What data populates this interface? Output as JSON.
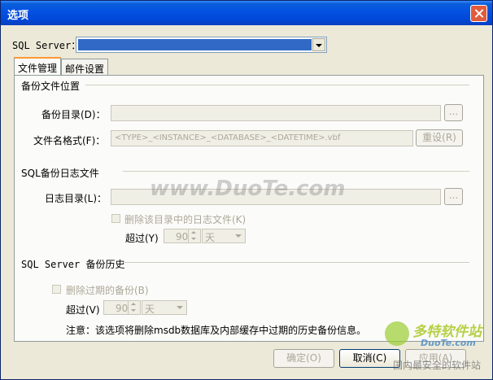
{
  "window": {
    "title": "选项"
  },
  "server": {
    "label": "SQL Server：",
    "value": ""
  },
  "tabs": [
    {
      "label": "文件管理",
      "active": true
    },
    {
      "label": "邮件设置",
      "active": false
    }
  ],
  "backup_file_location": {
    "heading": "备份文件位置",
    "dir_label": "备份目录(D)：",
    "dir_value": "",
    "browse_label": "...",
    "filename_label": "文件名格式(F)：",
    "filename_value": "<TYPE>_<INSTANCE>_<DATABASE>_<DATETIME>.vbf",
    "reset_label": "重设(R)"
  },
  "sql_log": {
    "heading": "SQL备份日志文件",
    "dir_label": "日志目录(L)：",
    "dir_value": "",
    "browse_label": "...",
    "delete_label": "删除该目录中的日志文件(K)",
    "over_label": "超过(Y)",
    "over_value": "90",
    "unit": "天"
  },
  "history": {
    "heading": "SQL Server 备份历史",
    "delete_label": "删除过期的备份(B)",
    "over_label": "超过(V)",
    "over_value": "90",
    "unit": "天",
    "note": "注意：该选项将删除msdb数据库及内部缓存中过期的历史备份信息。"
  },
  "footer": {
    "ok": "确定(O)",
    "cancel": "取消(C)",
    "apply": "应用(A)"
  },
  "watermarks": {
    "center": "www.DuoTe.com",
    "logo_title": "多特软件站",
    "logo_url": "DuoTe.com",
    "logo_sub": "国内最安全的软件站"
  },
  "colors": {
    "title_bar": "#0553e3",
    "selection": "#316ac5",
    "face": "#ece9d8",
    "close": "#e25b3b"
  },
  "icons": [
    "close-icon",
    "dropdown-arrow-icon",
    "spin-arrows-icon"
  ]
}
